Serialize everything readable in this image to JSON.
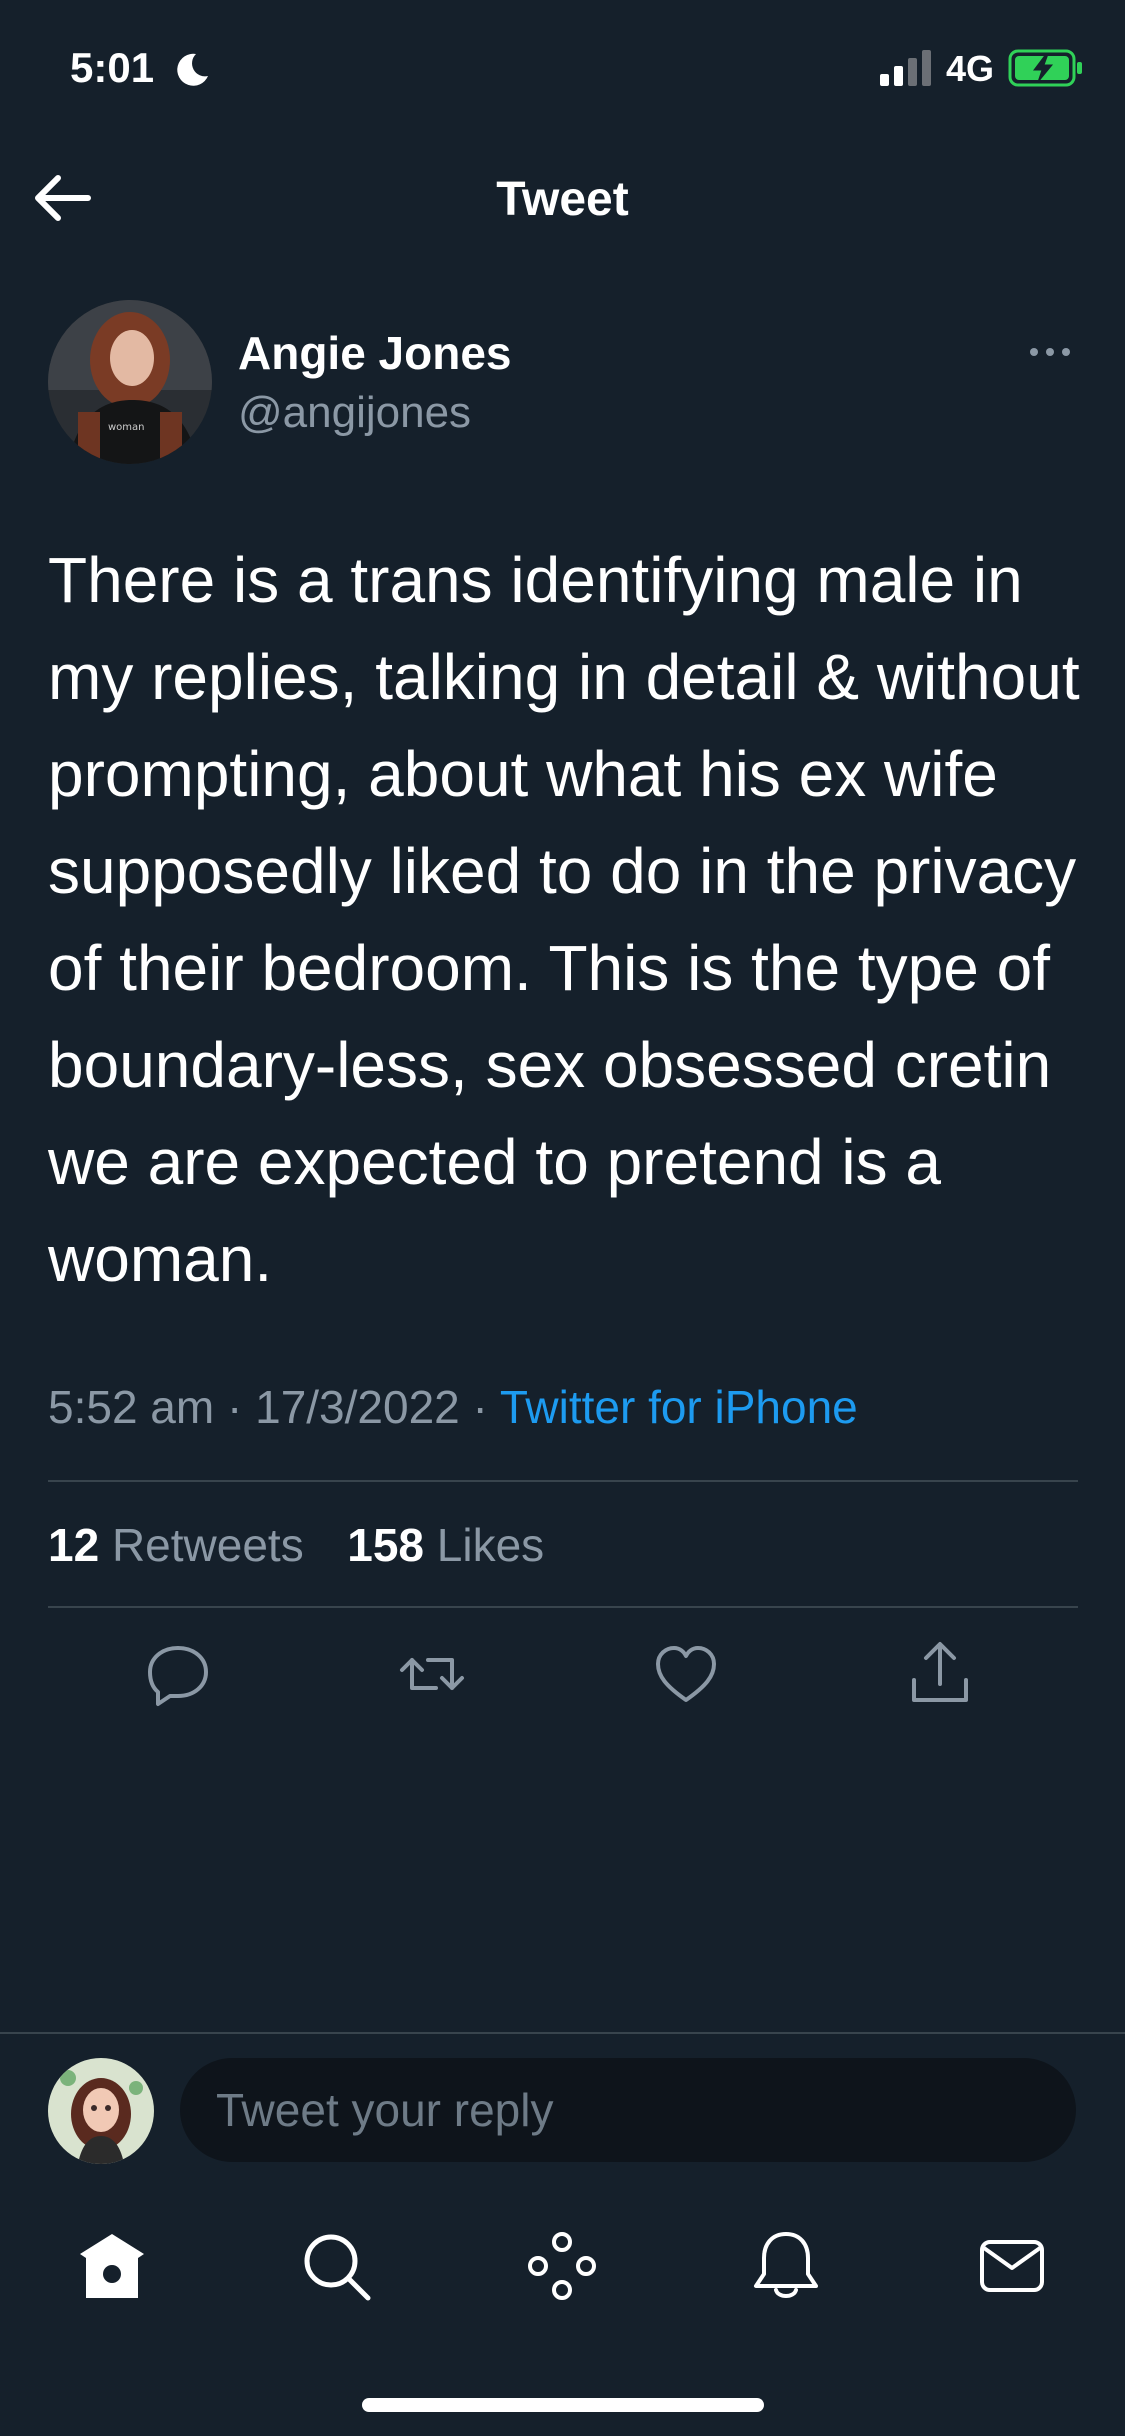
{
  "status_bar": {
    "time": "5:01",
    "network": "4G",
    "icons": [
      "moon-icon",
      "signal-icon",
      "battery-charging-icon"
    ],
    "battery_color": "#30d158"
  },
  "header": {
    "title": "Tweet",
    "back_icon": "arrow-left-icon"
  },
  "tweet": {
    "author_name": "Angie Jones",
    "author_handle": "@angijones",
    "text": "There is a trans identifying male in my replies, talking in detail & without prompting, about what his ex wife supposedly liked to do in the privacy of their bedroom. This is the type of boundary-less, sex obsessed cretin we are expected to pretend is a woman.",
    "time": "5:52 am",
    "date": "17/3/2022",
    "separator": " · ",
    "source": "Twitter for iPhone",
    "retweets_count": "12",
    "retweets_label": "Retweets",
    "likes_count": "158",
    "likes_label": "Likes"
  },
  "actions": [
    "reply-icon",
    "retweet-icon",
    "like-icon",
    "share-icon"
  ],
  "reply_bar": {
    "placeholder": "Tweet your reply"
  },
  "tab_bar": [
    "home-icon",
    "search-icon",
    "spaces-icon",
    "notifications-icon",
    "messages-icon"
  ],
  "colors": {
    "background": "#15202b",
    "accent": "#1d9bf0",
    "secondary_text": "#8b98a5",
    "divider": "#38444d"
  }
}
